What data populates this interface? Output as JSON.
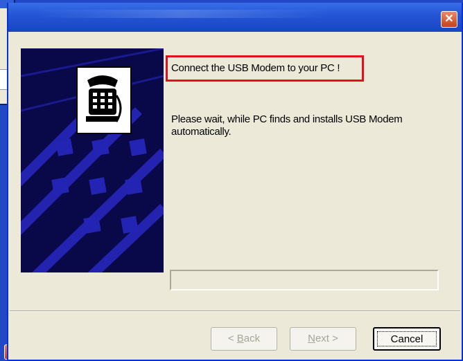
{
  "window": {
    "title": "",
    "close_glyph": "✕"
  },
  "background_window": {
    "close_glyph": "✕"
  },
  "wizard": {
    "image_icon": "telephone-icon",
    "headline": "Connect the USB Modem to your PC !",
    "description": "Please wait, while PC finds and installs USB Modem automatically.",
    "progress": 0
  },
  "buttons": {
    "back_label": "Back",
    "back_prefix": "< ",
    "back_mnemonic": "B",
    "next_label": "Next >",
    "next_mnemonic": "N",
    "cancel_label": "Cancel"
  },
  "colors": {
    "titlebar": "#2456d6",
    "highlight_border": "#e0101c",
    "art_background": "#09094a",
    "art_pattern": "#2020a8",
    "dialog_face": "#ece9d8"
  }
}
